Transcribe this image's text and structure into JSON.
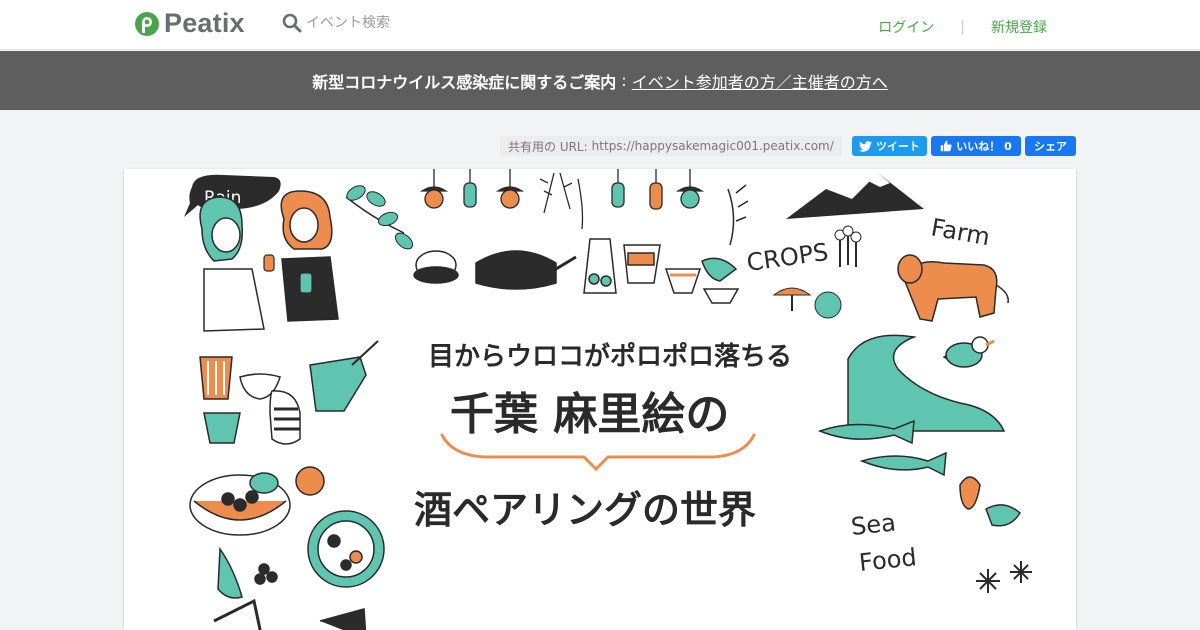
{
  "header": {
    "logo_text": "Peatix",
    "search_placeholder": "イベント検索",
    "login": "ログイン",
    "separator": "|",
    "signup": "新規登録"
  },
  "notice": {
    "bold_text": "新型コロナウイルス感染症に関するご案内",
    "colon": ":",
    "link_text": "イベント参加者の方／主催者の方へ"
  },
  "share": {
    "url_label": "共有用の URL:",
    "url": "https://happysakemagic001.peatix.com/",
    "tweet_label": "ツイート",
    "like_label": "いいね！ 0",
    "share_label": "シェア"
  },
  "cover": {
    "line1": "目からウロコがポロポロ落ちる",
    "line2": "千葉 麻里絵の",
    "line3": "酒ペアリングの世界",
    "tag_rain": "Rain",
    "tag_crops": "CROPS",
    "tag_farm": "Farm",
    "tag_sea": "Sea",
    "tag_food": "Food"
  },
  "colors": {
    "brand_green": "#4aa54a",
    "notice_bg": "#5e5e5e",
    "twitter_blue": "#1d9bf0",
    "facebook_blue": "#1877f2",
    "illustration_teal": "#5fc4b0",
    "illustration_orange": "#ec8c4d"
  }
}
